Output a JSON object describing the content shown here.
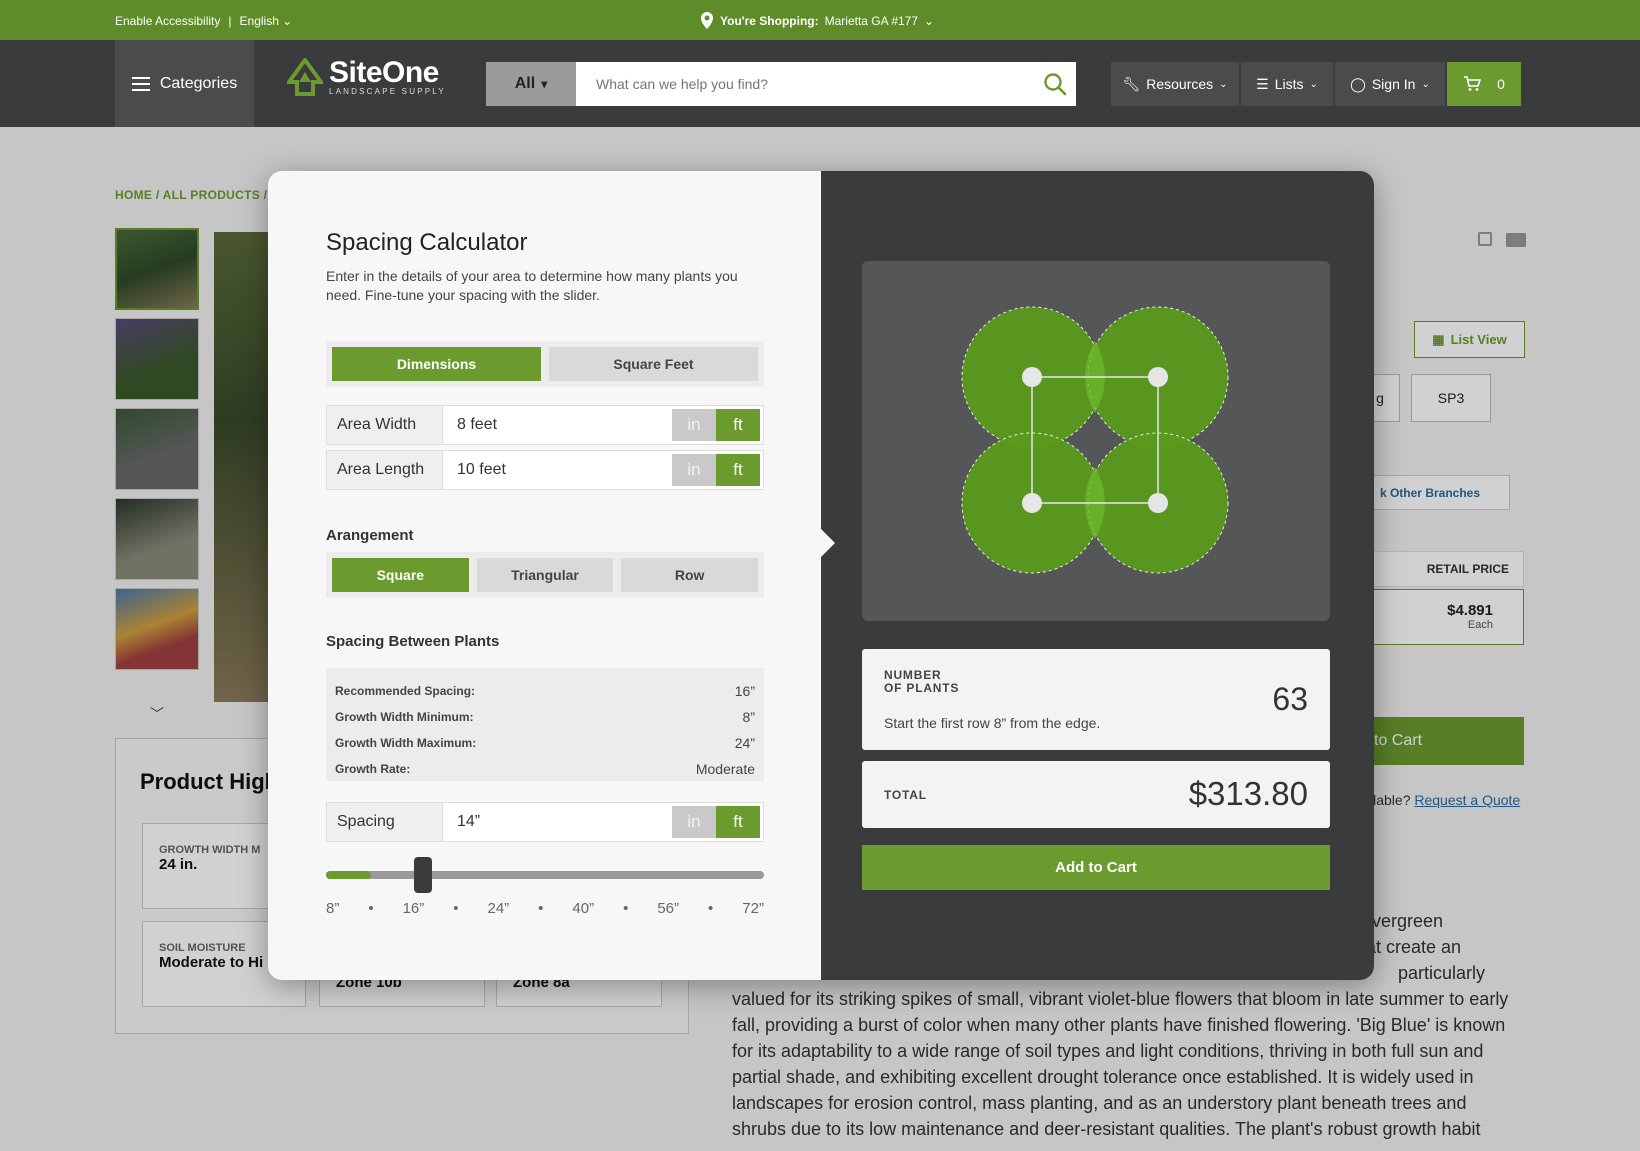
{
  "topbar": {
    "accessibility": "Enable Accessibility",
    "language": "English",
    "shopping_label": "You're Shopping:",
    "store": "Marietta GA #177"
  },
  "header": {
    "categories": "Categories",
    "logo_name": "SiteOne",
    "logo_sub": "LANDSCAPE SUPPLY",
    "search_scope": "All",
    "search_placeholder": "What can we help you find?",
    "nav": {
      "resources": "Resources",
      "lists": "Lists",
      "signin": "Sign In"
    },
    "cart_count": "0"
  },
  "page": {
    "breadcrumb": "HOME / ALL PRODUCTS /",
    "highlights_title": "Product Highlights",
    "highlight_cards": [
      {
        "label": "GROWTH WIDTH M",
        "value": "24 in."
      },
      {
        "label": "SOIL MOISTURE",
        "value": "Moderate to Hi"
      }
    ],
    "zone_a": "Zone 10b",
    "zone_b": "Zone 8a",
    "list_view": "List View",
    "size_partial": "g",
    "size_sp3": "SP3",
    "other_branches": "k Other Branches",
    "retail_price_label": "RETAIL PRICE",
    "retail_price": "$4.891",
    "price_unit": "Each",
    "add_to_cart_partial": "to Cart",
    "unavailable_text": "ilable?",
    "request_quote": "Request a Quote",
    "description_lines": [
      "vergreen",
      "at create an",
      "particularly",
      "valued for its striking spikes of small, vibrant violet-blue flowers that bloom in late summer to early",
      "fall, providing a burst of color when many other plants have finished flowering. 'Big Blue' is known",
      "for its adaptability to a wide range of soil types and light conditions, thriving in both full sun and",
      "partial shade, and exhibiting excellent drought tolerance once established. It is widely used in",
      "landscapes for erosion control, mass planting, and as an understory plant beneath trees and",
      "shrubs due to its low maintenance and deer-resistant qualities. The plant's robust growth habit"
    ]
  },
  "modal": {
    "title": "Spacing Calculator",
    "subtitle": "Enter in the details of your area to determine how many plants you need. Fine-tune your spacing with the slider.",
    "mode_tabs": [
      "Dimensions",
      "Square Feet"
    ],
    "width_label": "Area Width",
    "width_value": "8 feet",
    "length_label": "Area Length",
    "length_value": "10 feet",
    "unit_in": "in",
    "unit_ft": "ft",
    "arrangement_heading": "Arangement",
    "arrangements": [
      "Square",
      "Triangular",
      "Row"
    ],
    "spacing_heading": "Spacing Between Plants",
    "specs": [
      {
        "label": "Recommended Spacing:",
        "value": "16”"
      },
      {
        "label": "Growth Width Minimum:",
        "value": "8”"
      },
      {
        "label": "Growth Width Maximum:",
        "value": "24”"
      },
      {
        "label": "Growth Rate:",
        "value": "Moderate"
      }
    ],
    "spacing_label": "Spacing",
    "spacing_value": "14”",
    "slider_fraction": 0.094,
    "slider_ticks": [
      "8”",
      "•",
      "16”",
      "•",
      "24”",
      "•",
      "40”",
      "•",
      "56”",
      "•",
      "72”"
    ],
    "plants_label_1": "NUMBER",
    "plants_label_2": "OF PLANTS",
    "plants_count": "63",
    "plants_note": "Start the first row 8” from the edge.",
    "total_label": "TOTAL",
    "total_value": "$313.80",
    "add_to_cart": "Add to Cart"
  },
  "colors": {
    "brand_green": "#6b9a2e",
    "topbar_green": "#5e8c28",
    "header_dark": "#3a3b3c"
  }
}
